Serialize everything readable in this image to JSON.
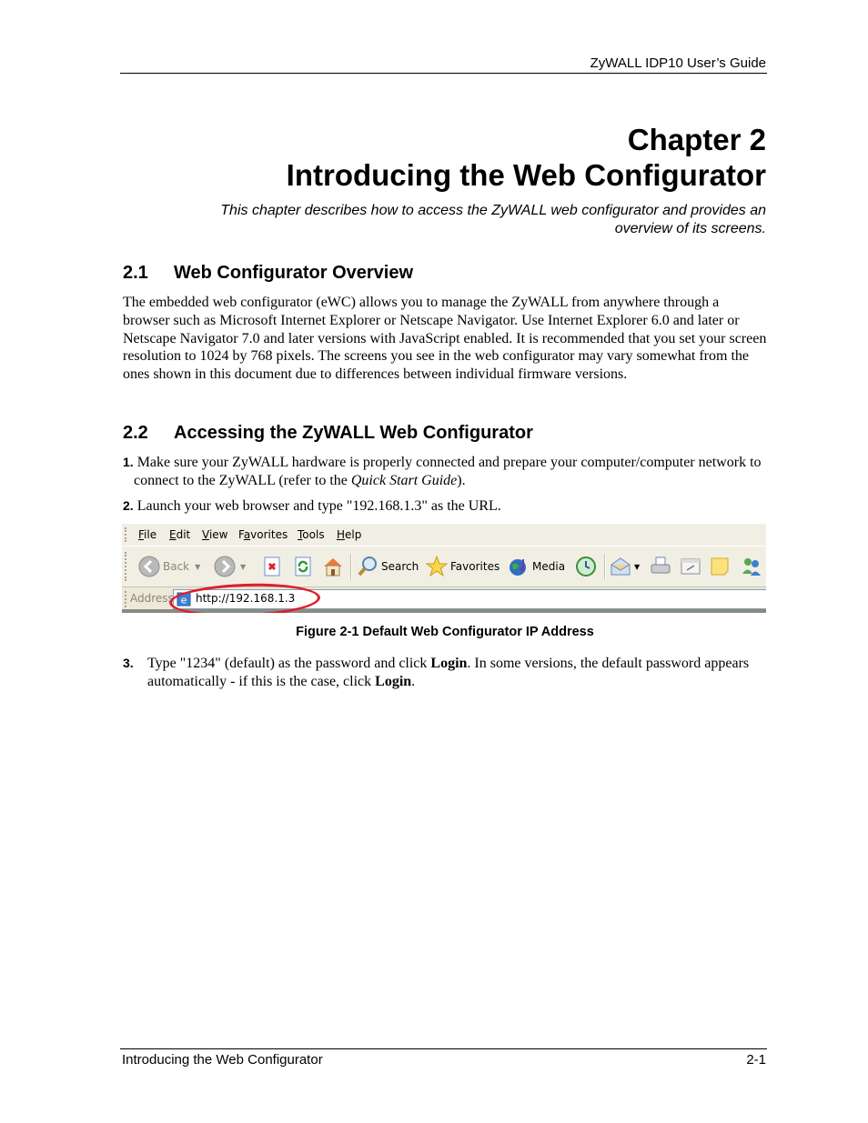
{
  "header": {
    "guide_title": "ZyWALL IDP10 User’s Guide"
  },
  "chapter": {
    "number_label": "Chapter 2",
    "title": "Introducing the Web Configurator",
    "intro": "This chapter describes how to access the ZyWALL web configurator and provides an overview of its screens."
  },
  "sections": [
    {
      "number": "2.1",
      "title": "Web Configurator Overview",
      "body": "The embedded web configurator (eWC) allows you to manage the ZyWALL from anywhere through a browser such as Microsoft Internet Explorer or Netscape Navigator. Use Internet Explorer 6.0 and later or Netscape Navigator 7.0 and later versions with JavaScript enabled. It is recommended that you set your screen resolution to 1024 by 768 pixels. The screens you see in the web configurator may vary somewhat from the ones shown in this document due to differences between individual firmware versions."
    },
    {
      "number": "2.2",
      "title": "Accessing the ZyWALL Web Configurator",
      "steps": [
        {
          "num": "1.",
          "text_before": "Make sure your ZyWALL hardware is properly connected and prepare your computer/computer network to connect to the ZyWALL (refer to the ",
          "italic": "Quick Start Guide",
          "text_after": ")."
        },
        {
          "num": "2.",
          "text": "Launch your web browser and type \"192.168.1.3\" as the URL."
        },
        {
          "num": "3.",
          "text_a": "Type \"1234\" (default) as the password and click ",
          "bold_a": "Login",
          "text_b": ". In some versions, the default password appears automatically - if this is the case, click ",
          "bold_b": "Login",
          "text_c": "."
        }
      ]
    }
  ],
  "figure": {
    "caption": "Figure 2-1 Default Web Configurator IP Address",
    "browser": {
      "menu": [
        "File",
        "Edit",
        "View",
        "Favorites",
        "Tools",
        "Help"
      ],
      "menu_access_keys": [
        "F",
        "E",
        "V",
        "a",
        "T",
        "H"
      ],
      "toolbar": {
        "back_label": "Back",
        "search_label": "Search",
        "favorites_label": "Favorites",
        "media_label": "Media"
      },
      "address_label": "Address",
      "address_value": "http://192.168.1.3",
      "highlight_color": "#e01e2a"
    }
  },
  "footer": {
    "chapter_title": "Introducing the Web Configurator",
    "page_number": "2-1"
  }
}
